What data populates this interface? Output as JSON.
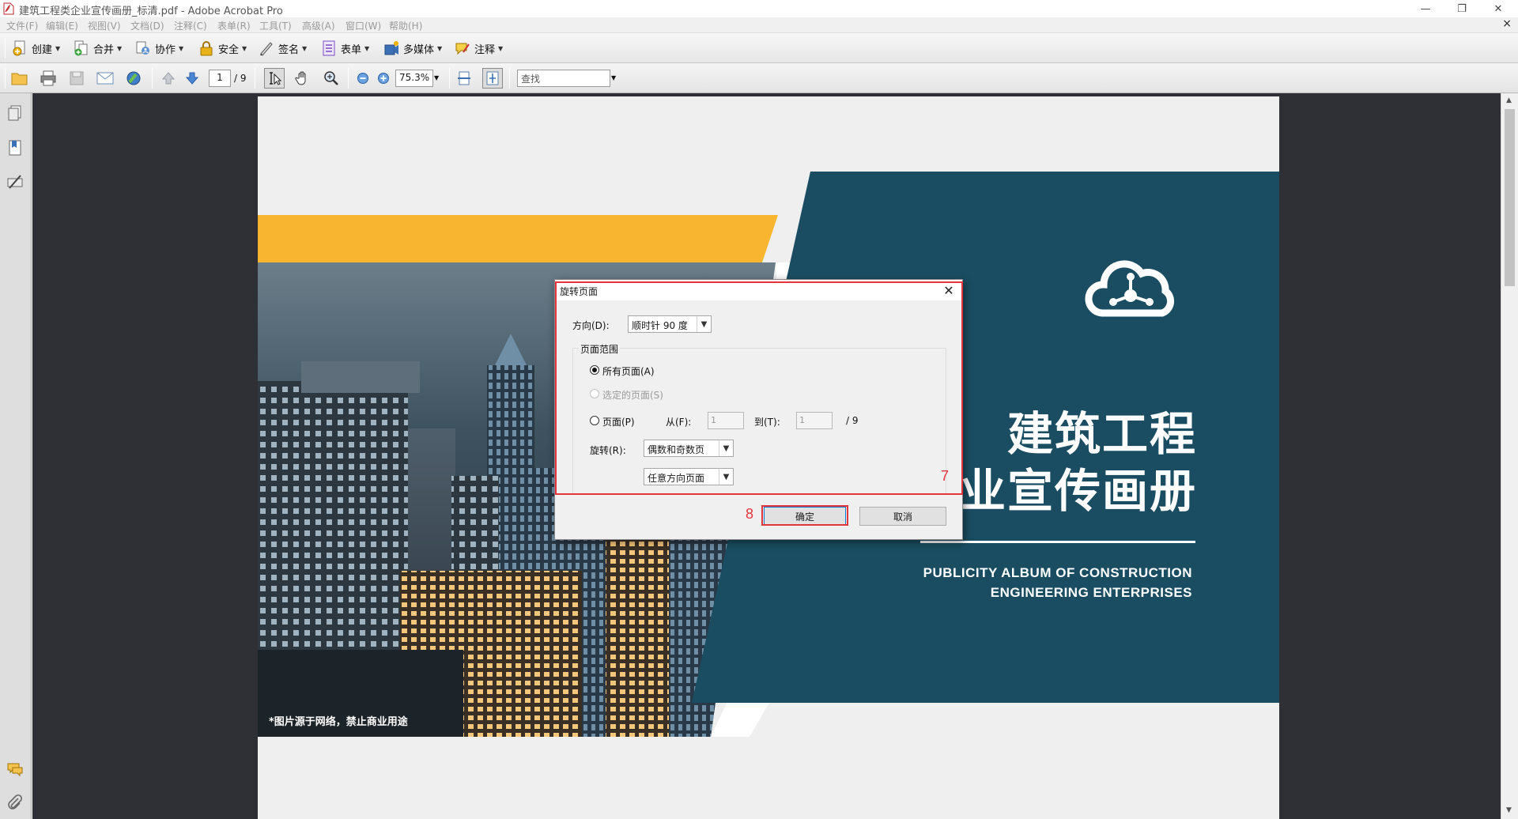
{
  "window": {
    "title": "建筑工程类企业宣传画册_标清.pdf - Adobe Acrobat Pro",
    "minimize_glyph": "—",
    "restore_glyph": "❐",
    "close_glyph": "✕"
  },
  "menu": {
    "items": [
      "文件(F)",
      "编辑(E)",
      "视图(V)",
      "文档(D)",
      "注释(C)",
      "表单(R)",
      "工具(T)",
      "高级(A)",
      "窗口(W)",
      "帮助(H)"
    ],
    "close_doc": "×"
  },
  "toolbar1": {
    "items": [
      {
        "label": "创建",
        "icon": "create-pdf-icon"
      },
      {
        "label": "合并",
        "icon": "combine-files-icon"
      },
      {
        "label": "协作",
        "icon": "collaborate-icon"
      },
      {
        "label": "安全",
        "icon": "lock-icon"
      },
      {
        "label": "签名",
        "icon": "pen-sign-icon"
      },
      {
        "label": "表单",
        "icon": "form-icon"
      },
      {
        "label": "多媒体",
        "icon": "multimedia-icon"
      },
      {
        "label": "注释",
        "icon": "comment-icon"
      }
    ]
  },
  "toolbar2": {
    "page_current": "1",
    "page_total": "/ 9",
    "zoom": "75.3%",
    "search_placeholder": "查找"
  },
  "document": {
    "title_line1": "建筑工程",
    "title_line2": "业宣传画册",
    "subtitle_line1": "PUBLICITY ALBUM OF CONSTRUCTION",
    "subtitle_line2": "ENGINEERING ENTERPRISES",
    "caption": "*图片源于网络，禁止商业用途"
  },
  "dialog": {
    "title": "旋转页面",
    "direction_label": "方向(D):",
    "direction_value": "顺时针 90 度",
    "group_label": "页面范围",
    "radio_all": "所有页面(A)",
    "radio_selected": "选定的页面(S)",
    "radio_pages": "页面(P)",
    "from_label": "从(F):",
    "from_value": "1",
    "to_label": "到(T):",
    "to_value": "1",
    "total": "/ 9",
    "rotate_label": "旋转(R):",
    "rotate_value": "偶数和奇数页",
    "orientation_value": "任意方向页面",
    "ok": "确定",
    "cancel": "取消",
    "selected_radio": "all"
  },
  "annotations": {
    "step7": "7",
    "step8": "8",
    "color": "#e5343c"
  },
  "colors": {
    "teal": "#1a4d61",
    "orange": "#f8b530",
    "viewer_bg": "#2f3035"
  }
}
